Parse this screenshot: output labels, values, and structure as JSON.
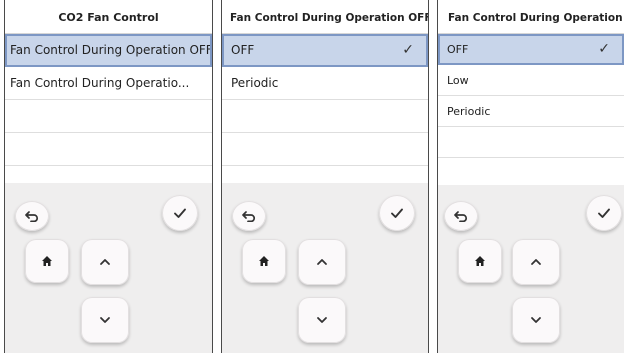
{
  "panels": [
    {
      "title": "CO2 Fan Control",
      "items": [
        {
          "label": "Fan Control During Operation OFF"
        },
        {
          "label": "Fan Control During Operatio..."
        }
      ]
    },
    {
      "title": "Fan Control During Operation OFF",
      "items": [
        {
          "label": "OFF",
          "check": "✓"
        },
        {
          "label": "Periodic"
        }
      ]
    },
    {
      "title": "Fan Control During Operation ON",
      "items": [
        {
          "label": "OFF",
          "check": "✓"
        },
        {
          "label": "Low"
        },
        {
          "label": "Periodic"
        }
      ]
    }
  ],
  "icons": {
    "back": "back-arrow-icon",
    "ok": "checkmark-icon",
    "home": "home-icon",
    "up": "chevron-up-icon",
    "down": "chevron-down-icon"
  },
  "colors": {
    "selected_bg": "#c8d5ea",
    "selected_border": "#7d97c4",
    "pad_bg": "#efeeee"
  }
}
